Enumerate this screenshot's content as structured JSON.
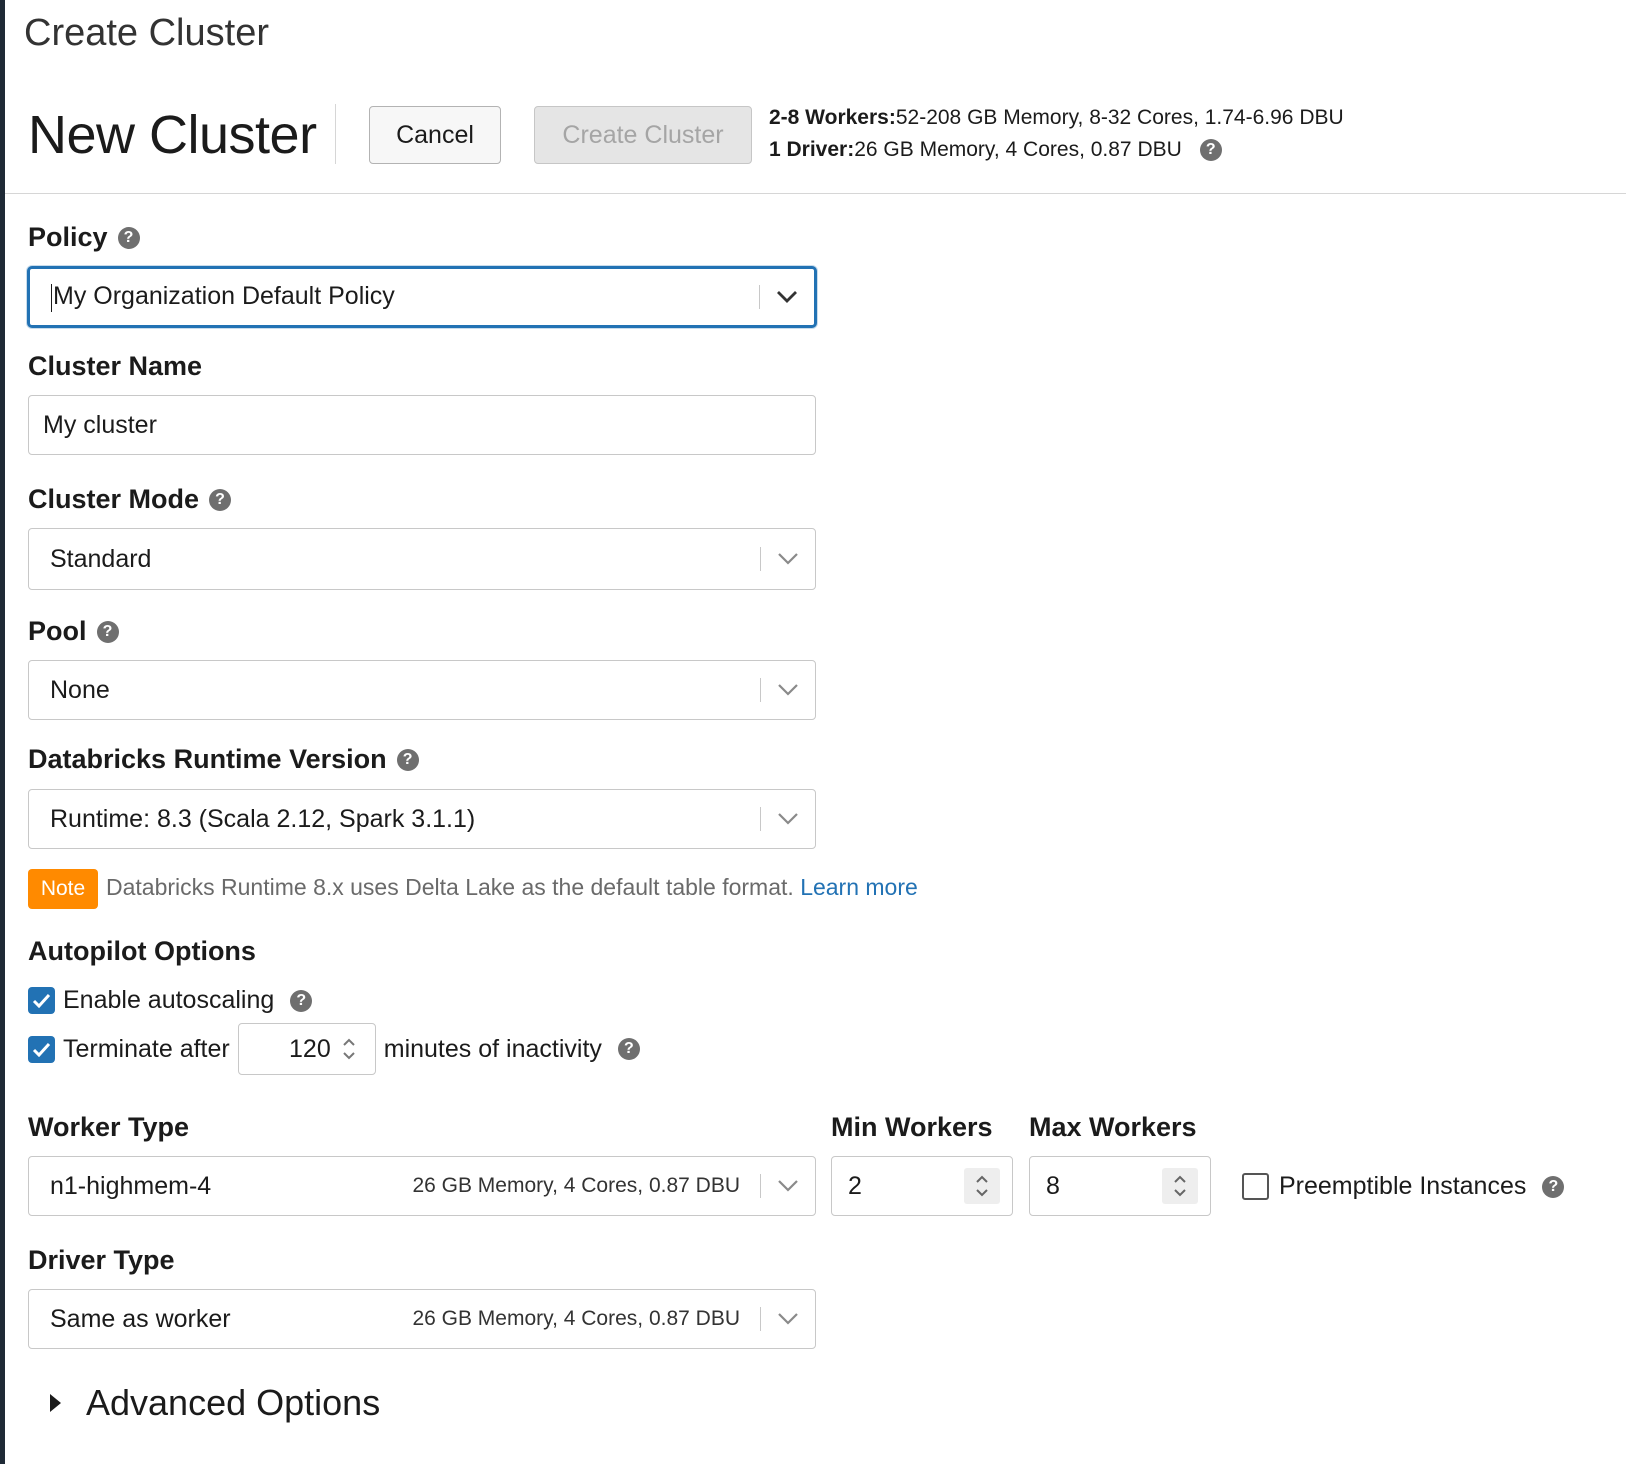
{
  "page": {
    "title": "Create Cluster"
  },
  "header": {
    "title": "New Cluster",
    "cancel_label": "Cancel",
    "create_label": "Create Cluster",
    "workers_prefix": "2-8 Workers:",
    "workers_spec": "52-208 GB Memory, 8-32 Cores, 1.74-6.96 DBU",
    "driver_prefix": "1 Driver:",
    "driver_spec": "26 GB Memory, 4 Cores, 0.87 DBU"
  },
  "policy": {
    "label": "Policy",
    "value": "My Organization Default Policy"
  },
  "cluster_name": {
    "label": "Cluster Name",
    "value": "My cluster"
  },
  "cluster_mode": {
    "label": "Cluster Mode",
    "value": "Standard"
  },
  "pool": {
    "label": "Pool",
    "value": "None"
  },
  "runtime": {
    "label": "Databricks Runtime Version",
    "value": "Runtime: 8.3 (Scala 2.12, Spark 3.1.1)"
  },
  "note": {
    "badge": "Note",
    "text": "Databricks Runtime 8.x uses Delta Lake as the default table format.",
    "link": "Learn more"
  },
  "autopilot": {
    "label": "Autopilot Options",
    "autoscaling_label": "Enable autoscaling",
    "autoscaling_checked": true,
    "terminate_label": "Terminate after",
    "terminate_checked": true,
    "terminate_minutes": "120",
    "terminate_suffix": "minutes of inactivity"
  },
  "worker_type": {
    "label": "Worker Type",
    "value": "n1-highmem-4",
    "spec": "26 GB Memory, 4 Cores, 0.87 DBU"
  },
  "min_workers": {
    "label": "Min Workers",
    "value": "2"
  },
  "max_workers": {
    "label": "Max Workers",
    "value": "8"
  },
  "preemptible": {
    "label": "Preemptible Instances",
    "checked": false
  },
  "driver_type": {
    "label": "Driver Type",
    "value": "Same as worker",
    "spec": "26 GB Memory, 4 Cores, 0.87 DBU"
  },
  "advanced": {
    "label": "Advanced Options"
  },
  "icons": {
    "help": "help-circle-icon",
    "chevron": "chevron-down-icon",
    "check": "check-icon",
    "spinner": "up-down-stepper-icon",
    "expand": "caret-right-icon"
  },
  "colors": {
    "accent": "#2272b4",
    "note": "#ff8a00",
    "disabled_text": "#a5a5a5"
  }
}
